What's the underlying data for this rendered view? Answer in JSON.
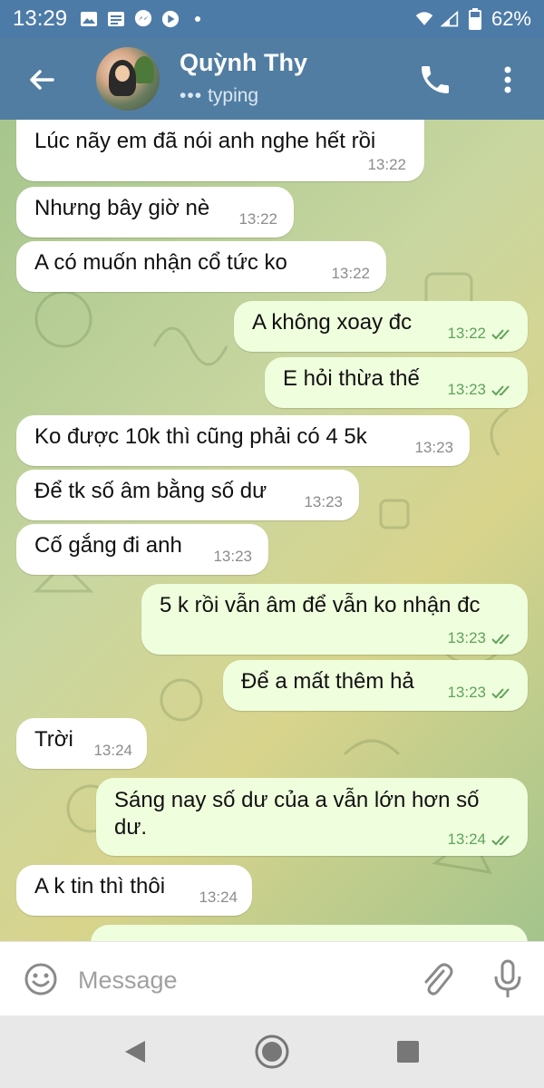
{
  "status_bar": {
    "time": "13:29",
    "battery": "62%",
    "icons": [
      "gallery-icon",
      "message-icon",
      "messenger-icon",
      "youtube-icon",
      "dot-icon",
      "wifi-icon",
      "signal-icon",
      "battery-icon"
    ]
  },
  "header": {
    "contact_name": "Quỳnh Thy",
    "status": "typing",
    "status_dots": "•••"
  },
  "messages": [
    {
      "dir": "in",
      "text": "Lúc nãy em đã nói anh nghe hết rồi",
      "time": "13:22"
    },
    {
      "dir": "in",
      "text": "Nhưng bây giờ nè",
      "time": "13:22"
    },
    {
      "dir": "in",
      "text": "A có muốn nhận cổ tức ko",
      "time": "13:22"
    },
    {
      "dir": "out",
      "text": "A không xoay đc",
      "time": "13:22",
      "read": true
    },
    {
      "dir": "out",
      "text": "E hỏi thừa thế",
      "time": "13:23",
      "read": true
    },
    {
      "dir": "in",
      "text": "Ko được 10k thì cũng phải có 4 5k",
      "time": "13:23"
    },
    {
      "dir": "in",
      "text": "Để tk số âm bằng số dư",
      "time": "13:23"
    },
    {
      "dir": "in",
      "text": "Cố gắng đi anh",
      "time": "13:23"
    },
    {
      "dir": "out",
      "text": "5 k rồi vẫn âm để vẫn ko nhận đc",
      "time": "13:23",
      "read": true
    },
    {
      "dir": "out",
      "text": "Để a mất thêm hả",
      "time": "13:23",
      "read": true
    },
    {
      "dir": "in",
      "text": "Trời",
      "time": "13:24"
    },
    {
      "dir": "out",
      "text": "Sáng nay số dư của a vẫn lớn hơn số dư.",
      "time": "13:24",
      "read": true
    },
    {
      "dir": "in",
      "text": "A k tin thì thôi",
      "time": "13:24"
    }
  ],
  "input": {
    "placeholder": "Message"
  },
  "colors": {
    "header": "#517da2",
    "status_bar": "#4d7ba8",
    "incoming_bubble": "#ffffff",
    "outgoing_bubble": "#effedd",
    "outgoing_time": "#5fa35a"
  }
}
